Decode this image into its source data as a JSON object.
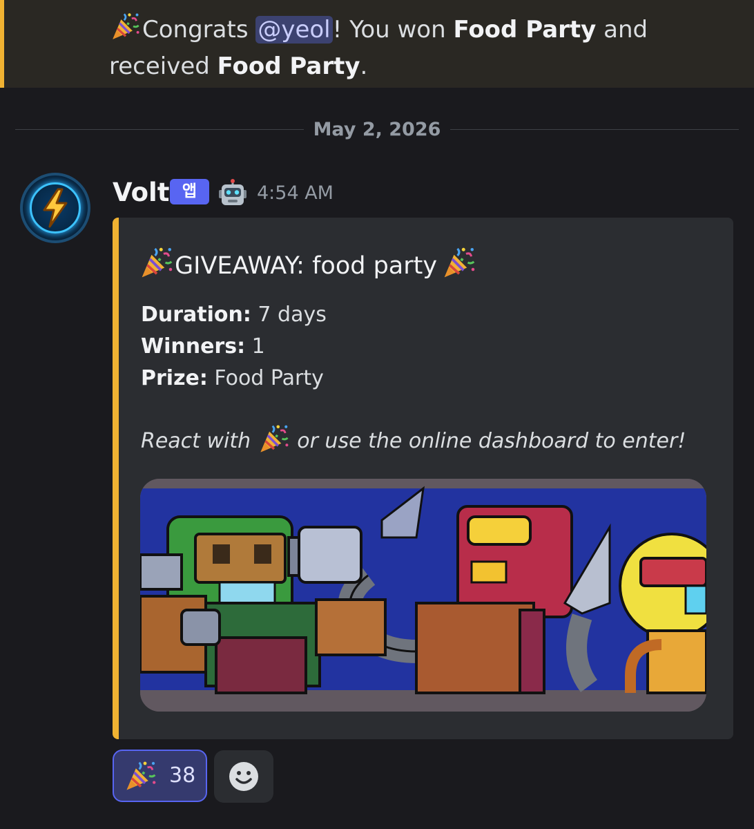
{
  "previous_message": {
    "emoji": "party-popper-icon",
    "text_before_mention": "Congrats ",
    "mention": "@yeol",
    "text_after_mention": "! You won ",
    "prize_1": "Food Party",
    "text_mid": " and received ",
    "prize_2": "Food Party",
    "text_end": "."
  },
  "date_divider": "May 2, 2026",
  "message": {
    "author": "Volt",
    "app_badge": "앱",
    "bot_icon": "robot-icon",
    "timestamp": "4:54 AM",
    "avatar_icon": "lightning-bolt-icon"
  },
  "embed": {
    "accent_color": "#f0b232",
    "title": "GIVEAWAY: food party",
    "fields": [
      {
        "label": "Duration:",
        "value": " 7 days"
      },
      {
        "label": "Winners:",
        "value": " 1"
      },
      {
        "label": "Prize:",
        "value": " Food Party"
      }
    ],
    "note_before": "React with ",
    "note_after": " or use the online dashboard to enter!",
    "image": "pixel-art-robots-banner"
  },
  "reactions": {
    "emoji": "party-popper-icon",
    "count": "38",
    "add_reaction_icon": "smiley-icon"
  },
  "colors": {
    "background": "#1a1a1e",
    "highlight_bg": "#2a2823",
    "brand": "#5865f2"
  }
}
